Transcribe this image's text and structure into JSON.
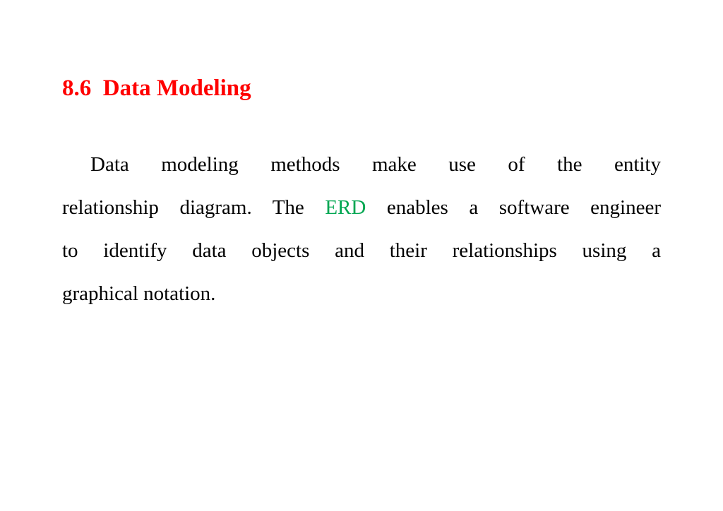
{
  "slide": {
    "title": "8.6  Data Modeling",
    "title_color": "#ff0000",
    "paragraph": {
      "lines": [
        {
          "text": "Data   modeling   methods   make   use   of   the   entity"
        },
        {
          "before": "relationship  diagram. The ",
          "highlight": "ERD",
          "after": " enables a software engineer"
        },
        {
          "text": "to  identify   data  objects  and  their  relationships  using  a"
        },
        {
          "text": "graphical notation."
        }
      ],
      "highlight_color": "#00a651"
    }
  }
}
